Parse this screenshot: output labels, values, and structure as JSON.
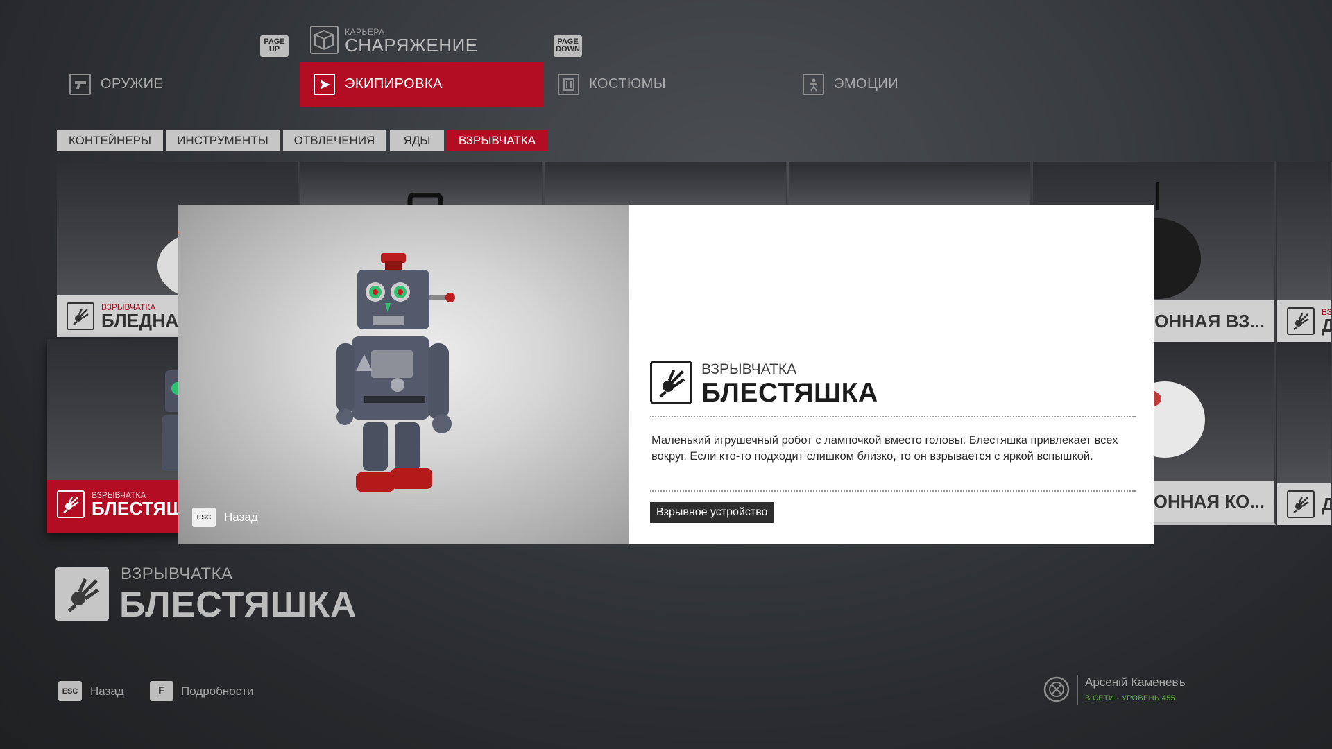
{
  "header": {
    "page_up_key": "PAGE\nUP",
    "page_down_key": "PAGE\nDOWN",
    "section_small": "КАРЬЕРА",
    "section_title": "СНАРЯЖЕНИЕ"
  },
  "main_tabs": [
    {
      "label": "ОРУЖИЕ",
      "icon": "pistol-icon"
    },
    {
      "label": "ЭКИПИРОВКА",
      "icon": "play-icon"
    },
    {
      "label": "КОСТЮМЫ",
      "icon": "wardrobe-icon"
    },
    {
      "label": "ЭМОЦИИ",
      "icon": "emote-icon"
    }
  ],
  "sub_tabs": [
    "КОНТЕЙНЕРЫ",
    "ИНСТРУМЕНТЫ",
    "ОТВЛЕЧЕНИЯ",
    "ЯДЫ",
    "ВЗРЫВЧАТКА"
  ],
  "grid": {
    "card_top_left": {
      "category": "ВЗРЫВЧАТКА",
      "name": "БЛЕДНАЯ"
    },
    "card_top_right": {
      "name": "ДИОННАЯ ВЗ..."
    },
    "card_top_far": {
      "category": "ВЗ",
      "name": "Д"
    },
    "card_selected": {
      "category": "ВЗРЫВЧАТКА",
      "name": "БЛЕСТЯШ"
    },
    "card_mid_right": {
      "name": "ДИОННАЯ КО..."
    },
    "card_mid_far": {
      "name": "Д"
    }
  },
  "modal": {
    "back_key": "ESC",
    "back_label": "Назад",
    "category": "ВЗРЫВЧАТКА",
    "name": "БЛЕСТЯШКА",
    "description": "Маленький игрушечный робот с лампочкой вместо головы. Блестяшка привлекает всех вокруг. Если кто-то подходит слишком близко, то он взрывается с яркой вспышкой.",
    "tag": "Взрывное устройство"
  },
  "selected_item": {
    "category": "ВЗРЫВЧАТКА",
    "name": "БЛЕСТЯШКА"
  },
  "hints": [
    {
      "key": "ESC",
      "label": "Назад"
    },
    {
      "key": "F",
      "label": "Подробности"
    }
  ],
  "profile": {
    "name": "Арсеній Каменевъ",
    "status": "В СЕТИ - УРОВЕНЬ 455"
  },
  "colors": {
    "accent": "#b20d22",
    "status_online": "#5fb03e"
  }
}
